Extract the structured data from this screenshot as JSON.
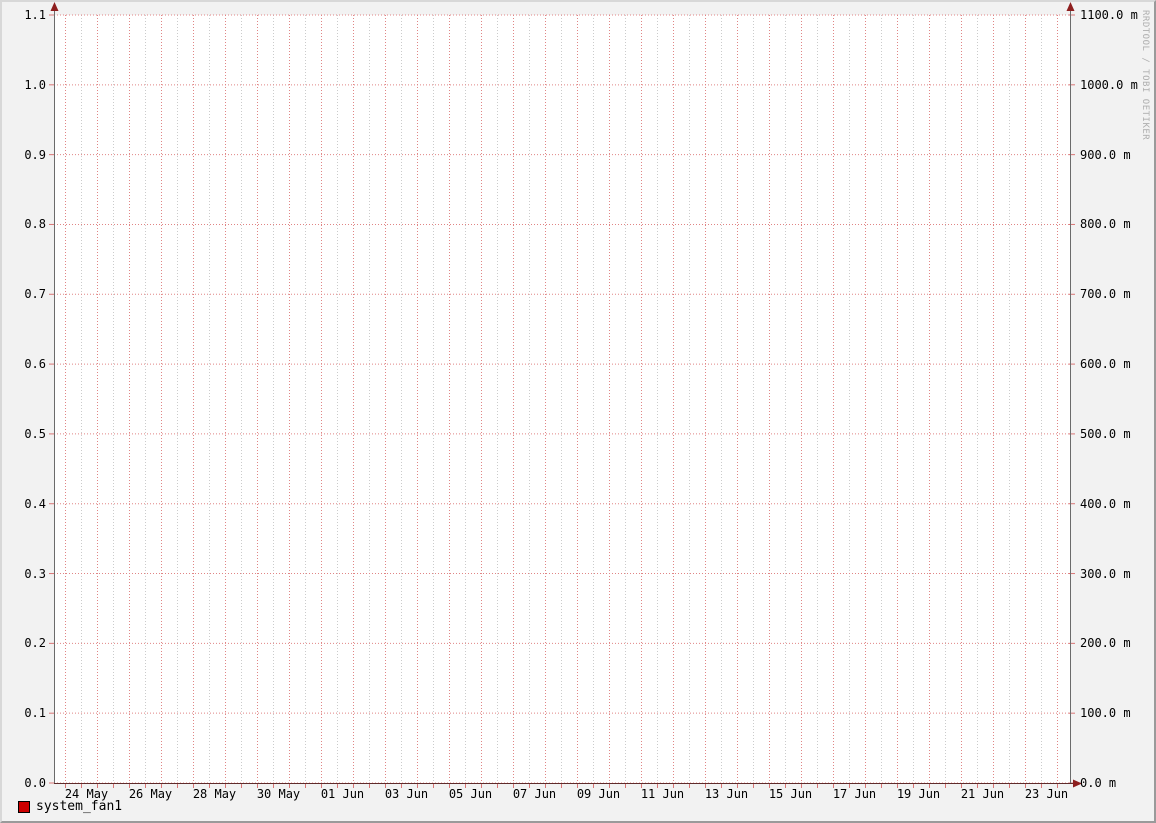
{
  "watermark": "RRDTOOL / TOBI OETIKER",
  "legend": {
    "items": [
      {
        "label": "system_fan1",
        "color": "#cc0000"
      }
    ]
  },
  "colors": {
    "background": "#f2f2f2",
    "canvas": "#ffffff",
    "major_grid": "#e08585",
    "minor_grid": "#cbcbcb",
    "axis_y": "#6b6b6b",
    "axis_x": "#5f2b2b",
    "arrow": "#8e1f1f",
    "tick": "#d97575",
    "border_light": "#d8d8d8",
    "border_dark": "#9a9a9a",
    "watermark_text": "#aeaeae"
  },
  "chart_data": {
    "type": "line",
    "title": "",
    "xlabel": "",
    "ylabel": "",
    "grid": "on",
    "legend_position": "bottom-left",
    "x_tick_labels": [
      "24 May",
      "26 May",
      "28 May",
      "30 May",
      "01 Jun",
      "03 Jun",
      "05 Jun",
      "07 Jun",
      "09 Jun",
      "11 Jun",
      "13 Jun",
      "15 Jun",
      "17 Jun",
      "19 Jun",
      "21 Jun",
      "23 Jun"
    ],
    "x_tick_interval_days": 2,
    "x_minor_grid_interval_hours": 12,
    "x_major_grid_interval_days": 1,
    "y_left_tick_labels_top_to_bottom": [
      "1.1",
      "1.0",
      "0.9",
      "0.8",
      "0.7",
      "0.6",
      "0.5",
      "0.4",
      "0.3",
      "0.2",
      "0.1",
      "0.0"
    ],
    "y_left_range": [
      0.0,
      1.1
    ],
    "y_right_tick_labels_top_to_bottom": [
      "1100.0 m",
      "1000.0 m",
      "900.0 m",
      "800.0 m",
      "700.0 m",
      "600.0 m",
      "500.0 m",
      "400.0 m",
      "300.0 m",
      "200.0 m",
      "100.0 m",
      "0.0 m"
    ],
    "y_right_range_milli": [
      0.0,
      1100.0
    ],
    "series": [
      {
        "name": "system_fan1",
        "color": "#cc0000",
        "values": []
      }
    ]
  }
}
